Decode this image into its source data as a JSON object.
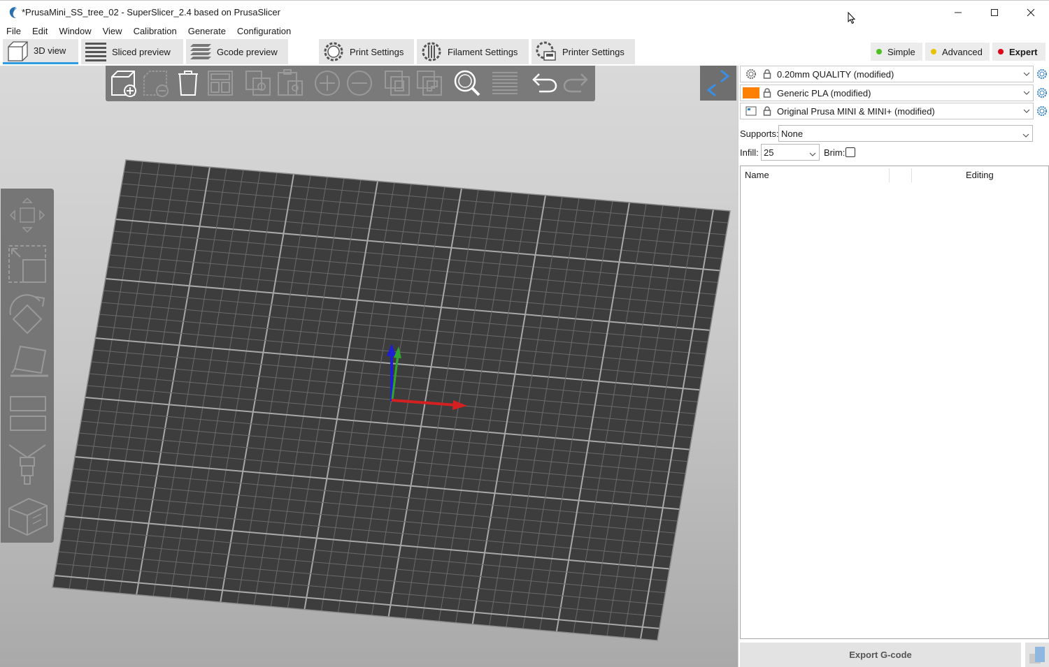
{
  "window": {
    "title": "*PrusaMini_SS_tree_02 - SuperSlicer_2.4  based on PrusaSlicer"
  },
  "menu": {
    "items": [
      "File",
      "Edit",
      "Window",
      "View",
      "Calibration",
      "Generate",
      "Configuration"
    ]
  },
  "tabs": {
    "view3d": "3D view",
    "sliced": "Sliced preview",
    "gcode": "Gcode preview",
    "print": "Print Settings",
    "filament": "Filament Settings",
    "printer": "Printer Settings"
  },
  "modes": {
    "simple": "Simple",
    "advanced": "Advanced",
    "expert": "Expert",
    "colors": {
      "simple": "#4fbf26",
      "advanced": "#e8c300",
      "expert": "#e0001a"
    }
  },
  "sidebar": {
    "print_preset": "0.20mm QUALITY (modified)",
    "filament_preset": "Generic PLA (modified)",
    "filament_color": "#ff8000",
    "printer_preset": "Original Prusa MINI & MINI+ (modified)",
    "supports_label": "Supports:",
    "supports_value": "None",
    "infill_label": "Infill:",
    "infill_value": "25",
    "brim_label": "Brim:",
    "brim_checked": false,
    "columns": {
      "name": "Name",
      "editing": "Editing"
    },
    "export_label": "Export G-code"
  },
  "colors": {
    "accent": "#2f9be0",
    "bed": "#3d3d3d",
    "axis_x": "#d42020",
    "axis_y": "#2fa52f",
    "axis_z": "#1f1fd0"
  }
}
